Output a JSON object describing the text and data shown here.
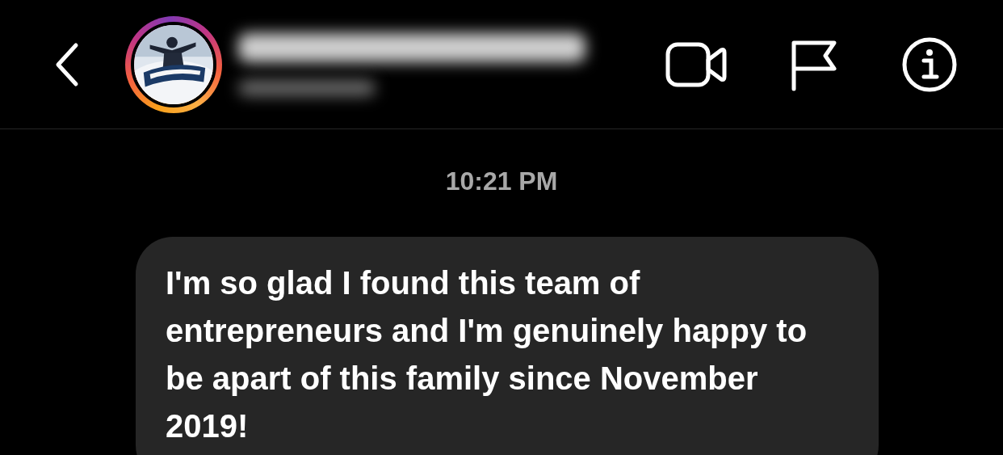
{
  "header": {
    "name_hidden": true
  },
  "messages": [
    {
      "kind": "time",
      "text": "10:21 PM"
    },
    {
      "kind": "received",
      "text": "I'm so glad I found this team of entrepreneurs and I'm genuinely happy to be apart of this family since November 2019!"
    }
  ]
}
